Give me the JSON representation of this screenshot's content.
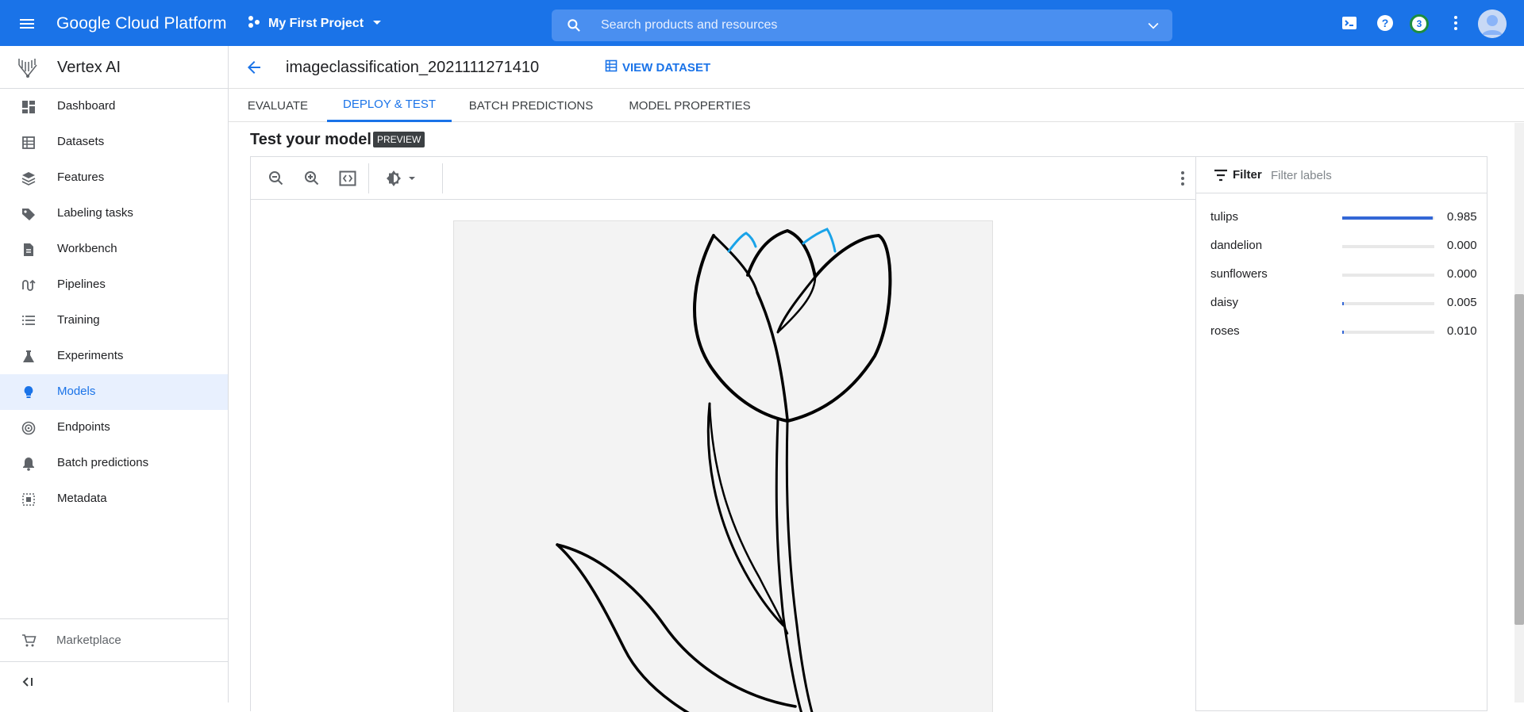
{
  "topbar": {
    "product_name": "Google Cloud Platform",
    "project_name": "My First Project",
    "search_placeholder": "Search products and resources",
    "notification_count": "3",
    "color": "#1a73e8"
  },
  "sidebar": {
    "title": "Vertex AI",
    "items": [
      {
        "label": "Dashboard",
        "icon": "dashboard-icon"
      },
      {
        "label": "Datasets",
        "icon": "datasets-icon"
      },
      {
        "label": "Features",
        "icon": "features-icon"
      },
      {
        "label": "Labeling tasks",
        "icon": "label-icon"
      },
      {
        "label": "Workbench",
        "icon": "workbench-icon"
      },
      {
        "label": "Pipelines",
        "icon": "pipelines-icon"
      },
      {
        "label": "Training",
        "icon": "training-icon"
      },
      {
        "label": "Experiments",
        "icon": "experiments-icon"
      },
      {
        "label": "Models",
        "icon": "models-icon",
        "active": true
      },
      {
        "label": "Endpoints",
        "icon": "endpoints-icon"
      },
      {
        "label": "Batch predictions",
        "icon": "batch-predictions-icon"
      },
      {
        "label": "Metadata",
        "icon": "metadata-icon"
      }
    ],
    "marketplace": "Marketplace"
  },
  "header": {
    "model_name": "imageclassification_2021111271410",
    "view_dataset": "VIEW DATASET"
  },
  "tabs": [
    {
      "label": "EVALUATE"
    },
    {
      "label": "DEPLOY & TEST",
      "active": true
    },
    {
      "label": "BATCH PREDICTIONS"
    },
    {
      "label": "MODEL PROPERTIES"
    }
  ],
  "test": {
    "title": "Test your model",
    "badge": "PREVIEW"
  },
  "labels_panel": {
    "filter_label": "Filter",
    "filter_placeholder": "Filter labels",
    "predictions": [
      {
        "label": "tulips",
        "score": "0.985",
        "value": 0.985
      },
      {
        "label": "dandelion",
        "score": "0.000",
        "value": 0.0
      },
      {
        "label": "sunflowers",
        "score": "0.000",
        "value": 0.0
      },
      {
        "label": "daisy",
        "score": "0.005",
        "value": 0.005
      },
      {
        "label": "roses",
        "score": "0.010",
        "value": 0.01
      }
    ],
    "bar_color": "#3367d6"
  }
}
